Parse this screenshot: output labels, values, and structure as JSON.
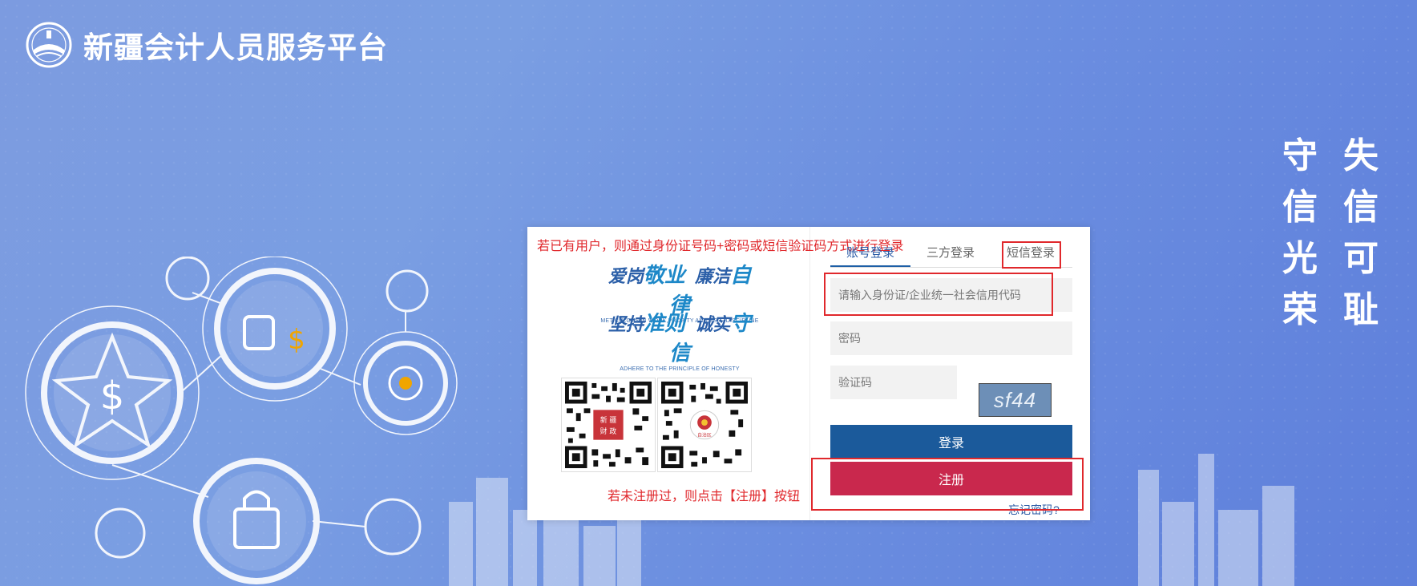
{
  "site": {
    "title": "新疆会计人员服务平台"
  },
  "motto": {
    "col_left": [
      "守",
      "信",
      "光",
      "荣"
    ],
    "col_right": [
      "失",
      "信",
      "可",
      "耻"
    ]
  },
  "card": {
    "notice_top": "若已有用户，则通过身份证号码+密码或短信验证码方式进行登录",
    "slogan1": {
      "prefix1": "爱岗",
      "main1": "敬业",
      "prefix2": "廉洁",
      "main2": "自律",
      "sub": "METICULOUS IN WORK,PROBITY AND SELF-DISCIPLINE"
    },
    "slogan2": {
      "prefix1": "坚持",
      "main1": "准则",
      "prefix2": "诚实",
      "main2": "守信",
      "sub": "ADHERE TO THE PRINCIPLE OF HONESTY"
    },
    "qr1_label": "新疆财政",
    "qr2_label": "自治区",
    "notice_bottom": "若未注册过，则点击【注册】按钮"
  },
  "login": {
    "tabs": [
      {
        "label": "账号登录"
      },
      {
        "label": "三方登录"
      },
      {
        "label": "短信登录"
      }
    ],
    "active_tab": 0,
    "id_placeholder": "请输入身份证/企业统一社会信用代码",
    "password_placeholder": "密码",
    "captcha_placeholder": "验证码",
    "captcha_text": "sf44",
    "login_label": "登录",
    "register_label": "注册",
    "forgot_label": "忘记密码?"
  },
  "colors": {
    "accent": "#1b5a9b",
    "register": "#c9284d",
    "notice": "#e0282c"
  }
}
